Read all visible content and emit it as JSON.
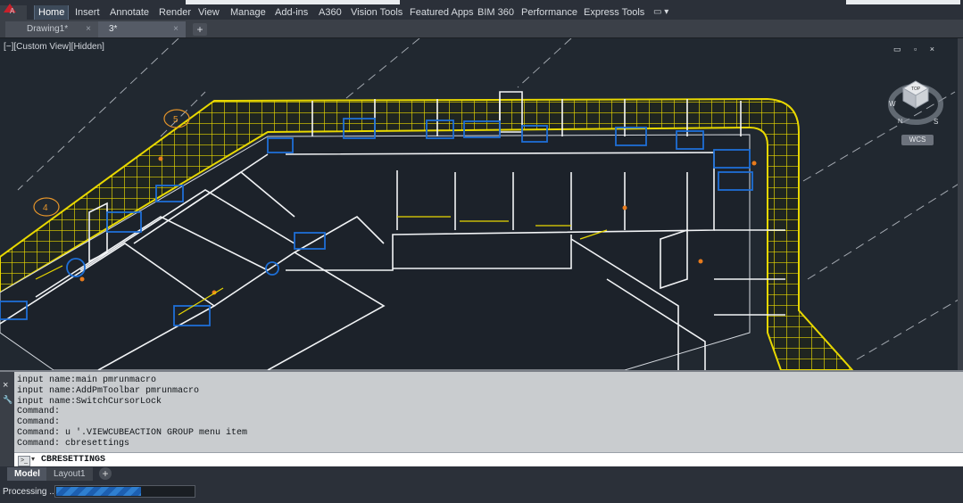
{
  "ribbon": {
    "tabs": [
      "Home",
      "Insert",
      "Annotate",
      "Render",
      "View",
      "Manage",
      "Add-ins",
      "A360",
      "Vision Tools",
      "Featured Apps",
      "BIM 360",
      "Performance",
      "Express Tools"
    ],
    "active": "Home",
    "app_button": "A",
    "extra": "▭ ▾"
  },
  "documents": {
    "tabs": [
      {
        "label": "Drawing1*",
        "close": "×"
      },
      {
        "label": "3*",
        "close": "×"
      }
    ],
    "new_tab": "+"
  },
  "viewport": {
    "label": "[−][Custom View][Hidden]",
    "controls": "▭ ▫ ×",
    "grid_labels": [
      "5",
      "4"
    ],
    "viewcube": {
      "face": "TOP",
      "n": "N",
      "w": "W",
      "s": "S"
    },
    "wcs": "WCS"
  },
  "command_line": {
    "side_icons": {
      "close": "×",
      "settings": "🔧"
    },
    "history": [
      "input name:main pmrunmacro",
      "input name:AddPmToolbar pmrunmacro",
      "input name:SwitchCursorLock",
      "Command:",
      "Command:",
      "Command: u '.VIEWCUBEACTION GROUP menu item",
      "Command: cbresettings"
    ],
    "prompt_button": ">_",
    "prompt_arrow": "▾",
    "input": "CBRESETTINGS"
  },
  "layouts": {
    "tabs": [
      "Model",
      "Layout1"
    ],
    "active": "Model",
    "add": "+"
  },
  "status": {
    "label": "Processing ...",
    "progress": 0.62
  },
  "colors": {
    "wall_yellow": "#e8d800",
    "accent_blue": "#1e6fd6",
    "background": "#212830"
  }
}
